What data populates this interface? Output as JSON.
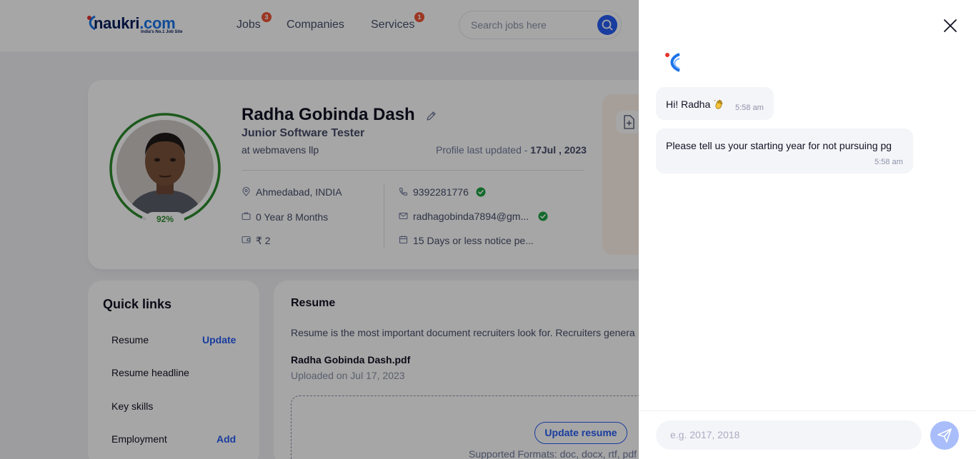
{
  "header": {
    "logo_text": "naukri",
    "logo_dot": ".com",
    "logo_tagline": "India's No.1 Job Site",
    "nav": [
      {
        "label": "Jobs",
        "badge": "3"
      },
      {
        "label": "Companies",
        "badge": ""
      },
      {
        "label": "Services",
        "badge": "1"
      }
    ],
    "search_placeholder": "Search jobs here"
  },
  "profile": {
    "name": "Radha Gobinda Dash",
    "designation": "Junior Software Tester",
    "company": "at webmavens llp",
    "last_updated_label": "Profile last updated - ",
    "last_updated_value": "17Jul , 2023",
    "completion": "92%",
    "location": "Ahmedabad, INDIA",
    "experience": "0 Year 8 Months",
    "salary": "₹ 2",
    "phone": "9392281776",
    "email": "radhagobinda7894@gm...",
    "notice": "15 Days or less notice pe..."
  },
  "quick_links": {
    "title": "Quick links",
    "items": [
      {
        "label": "Resume",
        "action": "Update"
      },
      {
        "label": "Resume headline",
        "action": ""
      },
      {
        "label": "Key skills",
        "action": ""
      },
      {
        "label": "Employment",
        "action": "Add"
      }
    ]
  },
  "resume": {
    "title": "Resume",
    "description": "Resume is the most important document recruiters look for. Recruiters genera",
    "file_name": "Radha Gobinda Dash.pdf",
    "uploaded": "Uploaded on Jul 17, 2023",
    "update_button": "Update resume",
    "formats": "Supported Formats: doc, docx, rtf, pdf"
  },
  "chat": {
    "messages": [
      {
        "text": "Hi! Radha",
        "time": "5:58 am"
      },
      {
        "text": "Please tell us your starting year for not pursuing pg",
        "time": "5:58 am"
      }
    ],
    "input_placeholder": "e.g. 2017, 2018"
  },
  "colors": {
    "primary": "#275df5",
    "badge": "#f05537",
    "progress": "#2b8a2b",
    "verified": "#1ea342"
  }
}
